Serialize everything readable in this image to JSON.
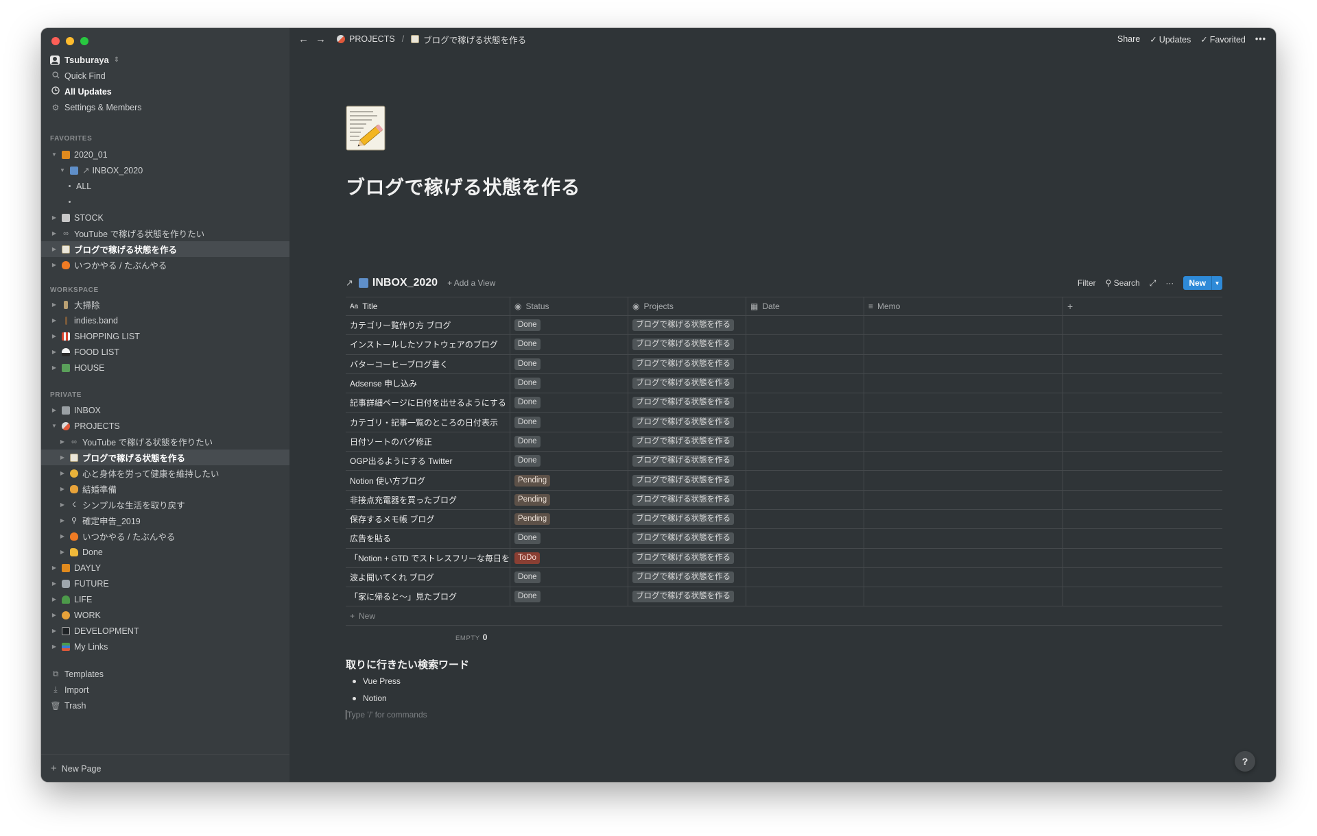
{
  "workspace": {
    "name": "Tsuburaya"
  },
  "sidebar": {
    "top": [
      {
        "label": "Quick Find",
        "icon": "search-icon"
      },
      {
        "label": "All Updates",
        "icon": "clock-icon"
      },
      {
        "label": "Settings & Members",
        "icon": "gear-icon"
      }
    ],
    "favorites_label": "FAVORITES",
    "favorites": [
      {
        "label": "2020_01",
        "icon": "notebook-icon"
      },
      {
        "label": "INBOX_2020",
        "icon": "inbox-tray-icon"
      },
      {
        "label": "ALL"
      },
      {
        "label": "STOCK",
        "icon": "floppy-disk-icon"
      },
      {
        "label": "YouTube で稼げる状態を作りたい",
        "icon": "link-icon"
      },
      {
        "label": "ブログで稼げる状態を作る",
        "icon": "memo-icon"
      },
      {
        "label": "いつかやる / たぶんやる",
        "icon": "fire-icon"
      }
    ],
    "workspace_label": "WORKSPACE",
    "workspace_items": [
      {
        "label": "大掃除",
        "icon": "broom-icon"
      },
      {
        "label": "indies.band",
        "icon": "guitar-icon"
      },
      {
        "label": "SHOPPING LIST",
        "icon": "store-icon"
      },
      {
        "label": "FOOD LIST",
        "icon": "onigiri-icon"
      },
      {
        "label": "HOUSE",
        "icon": "house-icon"
      }
    ],
    "private_label": "PRIVATE",
    "private_items": [
      {
        "label": "INBOX",
        "icon": "inbox-icon"
      },
      {
        "label": "PROJECTS",
        "icon": "rocket-icon"
      },
      {
        "label": "YouTube で稼げる状態を作りたい",
        "icon": "link-icon"
      },
      {
        "label": "ブログで稼げる状態を作る",
        "icon": "memo-icon"
      },
      {
        "label": "心と身体を労って健康を維持したい",
        "icon": "person-icon"
      },
      {
        "label": "結婚準備",
        "icon": "couple-icon"
      },
      {
        "label": "シンプルな生活を取り戻す",
        "icon": "leaf-icon"
      },
      {
        "label": "確定申告_2019",
        "icon": "magnifier-icon"
      },
      {
        "label": "いつかやる / たぶんやる",
        "icon": "fire-icon"
      },
      {
        "label": "Done",
        "icon": "thumbs-up-icon"
      },
      {
        "label": "DAYLY",
        "icon": "notebook-icon"
      },
      {
        "label": "FUTURE",
        "icon": "robot-icon"
      },
      {
        "label": "LIFE",
        "icon": "palm-icon"
      },
      {
        "label": "WORK",
        "icon": "worker-icon"
      },
      {
        "label": "DEVELOPMENT",
        "icon": "laptop-icon"
      },
      {
        "label": "My Links",
        "icon": "books-icon"
      }
    ],
    "bottom": [
      {
        "label": "Templates",
        "icon": "templates-icon"
      },
      {
        "label": "Import",
        "icon": "import-icon"
      },
      {
        "label": "Trash",
        "icon": "trash-icon"
      }
    ],
    "new_page": "New Page"
  },
  "topbar": {
    "crumb1": "PROJECTS",
    "crumb_sep": "/",
    "crumb2": "ブログで稼げる状態を作る",
    "share": "Share",
    "updates": "Updates",
    "favorited": "Favorited",
    "more": "•••"
  },
  "page": {
    "title": "ブログで稼げる状態を作る"
  },
  "database": {
    "name": "INBOX_2020",
    "add_view": "Add a View",
    "filter": "Filter",
    "search": "Search",
    "more": "···",
    "new": "New",
    "columns": [
      "Title",
      "Status",
      "Projects",
      "Date",
      "Memo"
    ],
    "rows": [
      {
        "title": "カテゴリー覧作り方 ブログ",
        "status": "Done",
        "project": "ブログで稼げる状態を作る"
      },
      {
        "title": "インストールしたソフトウェアのブログ",
        "status": "Done",
        "project": "ブログで稼げる状態を作る"
      },
      {
        "title": "バターコーヒーブログ書く",
        "status": "Done",
        "project": "ブログで稼げる状態を作る"
      },
      {
        "title": "Adsense 申し込み",
        "status": "Done",
        "project": "ブログで稼げる状態を作る"
      },
      {
        "title": "記事詳細ページに日付を出せるようにする",
        "status": "Done",
        "project": "ブログで稼げる状態を作る"
      },
      {
        "title": "カテゴリ・記事一覧のところの日付表示",
        "status": "Done",
        "project": "ブログで稼げる状態を作る"
      },
      {
        "title": "日付ソートのバグ修正",
        "status": "Done",
        "project": "ブログで稼げる状態を作る"
      },
      {
        "title": "OGP出るようにする Twitter",
        "status": "Done",
        "project": "ブログで稼げる状態を作る"
      },
      {
        "title": "Notion 使い方ブログ",
        "status": "Pending",
        "project": "ブログで稼げる状態を作る"
      },
      {
        "title": "非接点充電器を買ったブログ",
        "status": "Pending",
        "project": "ブログで稼げる状態を作る"
      },
      {
        "title": "保存するメモ帳 ブログ",
        "status": "Pending",
        "project": "ブログで稼げる状態を作る"
      },
      {
        "title": "広告を貼る",
        "status": "Done",
        "project": "ブログで稼げる状態を作る"
      },
      {
        "title": "「Notion + GTD でストレスフリーな毎日を",
        "status": "ToDo",
        "project": "ブログで稼げる状態を作る"
      },
      {
        "title": "波よ聞いてくれ ブログ",
        "status": "Done",
        "project": "ブログで稼げる状態を作る"
      },
      {
        "title": "「家に帰ると〜」見たブログ",
        "status": "Done",
        "project": "ブログで稼げる状態を作る"
      }
    ],
    "new_row": "New",
    "calc_label": "EMPTY",
    "calc_value": "0"
  },
  "content": {
    "heading": "取りに行きたい検索ワード",
    "bullets": [
      "Vue Press",
      "Notion"
    ],
    "placeholder": "Type '/' for commands"
  },
  "help": "?"
}
